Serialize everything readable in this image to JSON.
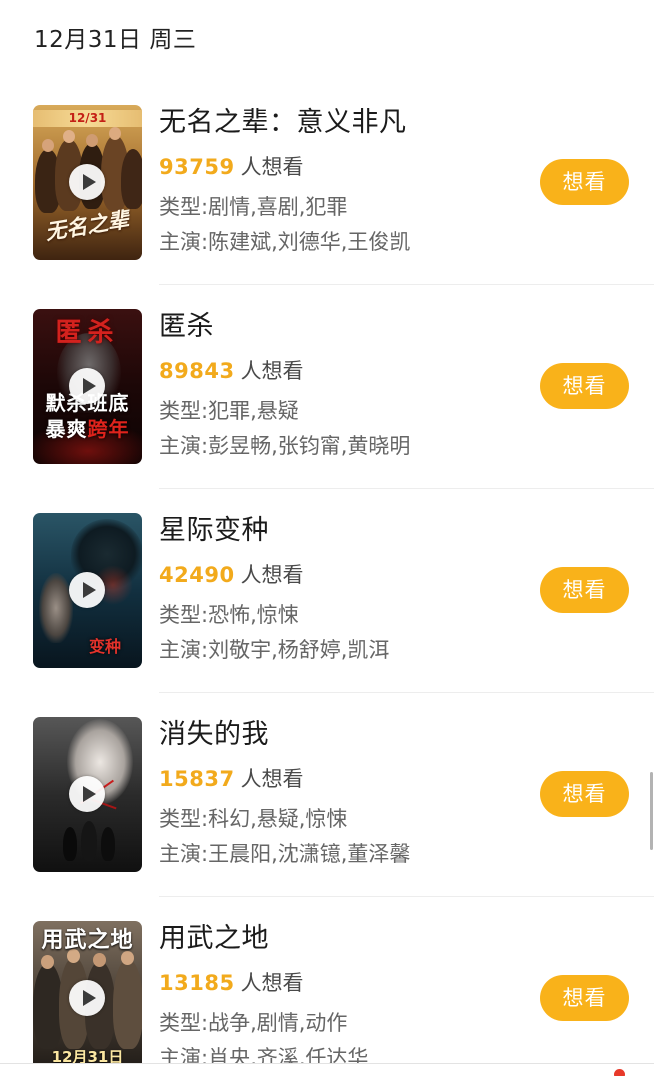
{
  "header": {
    "date": "12月31日 周三"
  },
  "theme": {
    "accent": "#f2aa1c",
    "button": "#f9b21a",
    "button_text": "#ffffff"
  },
  "icons": {
    "poster_play": "play-icon"
  },
  "movies": [
    {
      "title": "无名之辈：意义非凡",
      "want_count": "93759",
      "want_label": "人想看",
      "genre": "类型:剧情,喜剧,犯罪",
      "cast": "主演:陈建斌,刘德华,王俊凯",
      "button_label": "想看",
      "poster": {
        "colors": [
          "#d8aa5a",
          "#a06a2c",
          "#3f2410"
        ],
        "art_text": [
          "12/31",
          "无名之辈"
        ]
      }
    },
    {
      "title": "匿杀",
      "want_count": "89843",
      "want_label": "人想看",
      "genre": "类型:犯罪,悬疑",
      "cast": "主演:彭昱畅,张钧甯,黄晓明",
      "button_label": "想看",
      "poster": {
        "colors": [
          "#3b1010",
          "#1c0707",
          "#0c0303"
        ],
        "art_text": [
          "匿杀",
          "默杀班底",
          "暴爽",
          "跨年"
        ]
      }
    },
    {
      "title": "星际变种",
      "want_count": "42490",
      "want_label": "人想看",
      "genre": "类型:恐怖,惊悚",
      "cast": "主演:刘敬宇,杨舒婷,凯洱",
      "button_label": "想看",
      "poster": {
        "colors": [
          "#2a5566",
          "#123040",
          "#08151e"
        ],
        "art_text": [
          "变种"
        ]
      }
    },
    {
      "title": "消失的我",
      "want_count": "15837",
      "want_label": "人想看",
      "genre": "类型:科幻,悬疑,惊悚",
      "cast": "主演:王晨阳,沈潇镱,董泽馨",
      "button_label": "想看",
      "poster": {
        "colors": [
          "#575757",
          "#2b2b2b",
          "#101010"
        ],
        "art_text": []
      }
    },
    {
      "title": "用武之地",
      "want_count": "13185",
      "want_label": "人想看",
      "genre": "类型:战争,剧情,动作",
      "cast": "主演:肖央,齐溪,任达华",
      "button_label": "想看",
      "poster": {
        "colors": [
          "#7f7060",
          "#4a4036",
          "#1d1915"
        ],
        "art_text": [
          "用武之地",
          "12月31日"
        ]
      }
    }
  ]
}
